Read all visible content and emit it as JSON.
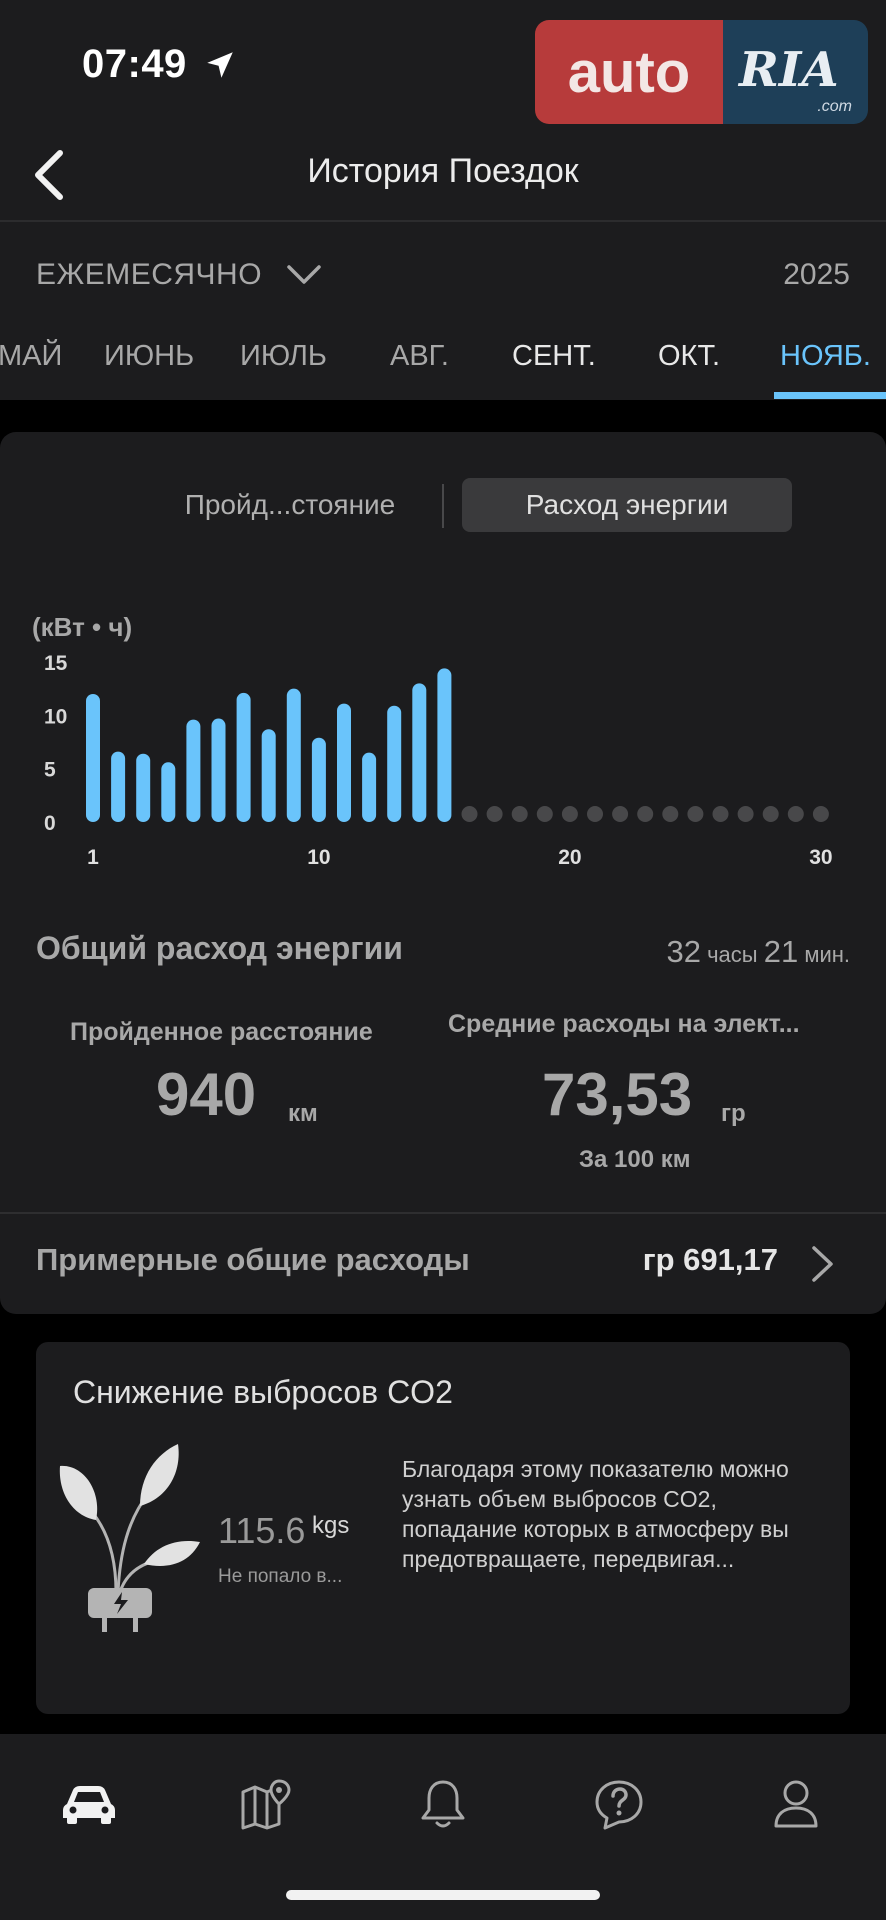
{
  "status_bar": {
    "time": "07:49"
  },
  "watermark": {
    "brand_left": "auto",
    "brand_right": "RIA",
    "domain": ".com"
  },
  "header": {
    "title": "История Поездок"
  },
  "period": {
    "selected": "ЕЖЕМЕСЯЧНО",
    "year": "2025",
    "months": [
      "МАЙ",
      "ИЮНЬ",
      "ИЮЛЬ",
      "АВГ.",
      "СЕНТ.",
      "ОКТ.",
      "НОЯБ."
    ],
    "active_month": "НОЯБ."
  },
  "segments": {
    "distance": "Пройд...стояние",
    "energy": "Расход энергии",
    "active": "energy"
  },
  "chart_data": {
    "type": "bar",
    "unit_label": "(кВт • ч)",
    "x_ticks": [
      "1",
      "10",
      "20",
      "30"
    ],
    "y_ticks": [
      "15",
      "10",
      "5",
      "0"
    ],
    "ylim": [
      0,
      15
    ],
    "days": [
      1,
      2,
      3,
      4,
      5,
      6,
      7,
      8,
      9,
      10,
      11,
      12,
      13,
      14,
      15,
      16,
      17,
      18,
      19,
      20,
      21,
      22,
      23,
      24,
      25,
      26,
      27,
      28,
      29,
      30
    ],
    "values": [
      12.0,
      6.6,
      6.4,
      5.6,
      9.6,
      9.7,
      12.1,
      8.7,
      12.5,
      7.9,
      11.1,
      6.5,
      10.9,
      13.0,
      14.4,
      null,
      null,
      null,
      null,
      null,
      null,
      null,
      null,
      null,
      null,
      null,
      null,
      null,
      null,
      null
    ],
    "bar_color": "#6ac4fb",
    "empty_color": "#48484a"
  },
  "summary": {
    "total_label": "Общий расход энергии",
    "hours": "32",
    "hours_unit": "часы",
    "minutes": "21",
    "minutes_unit": "мин.",
    "distance_label": "Пройденное расстояние",
    "distance_value": "940",
    "distance_unit": "км",
    "avg_label": "Средние расходы на элект...",
    "avg_value": "73,53",
    "avg_unit": "гр",
    "avg_sub": "За 100 км"
  },
  "cost": {
    "label": "Примерные общие расходы",
    "value": "гр 691,17"
  },
  "co2": {
    "title": "Снижение выбросов CO2",
    "value": "115.6",
    "unit": "kgs",
    "sub": "Не попало в...",
    "description": "Благодаря этому показателю можно узнать объем выбросов CO2, попадание которых в атмосферу вы предотвращаете, передвигая..."
  },
  "tabs": [
    "car-icon",
    "map-icon",
    "bell-icon",
    "help-icon",
    "profile-icon"
  ]
}
